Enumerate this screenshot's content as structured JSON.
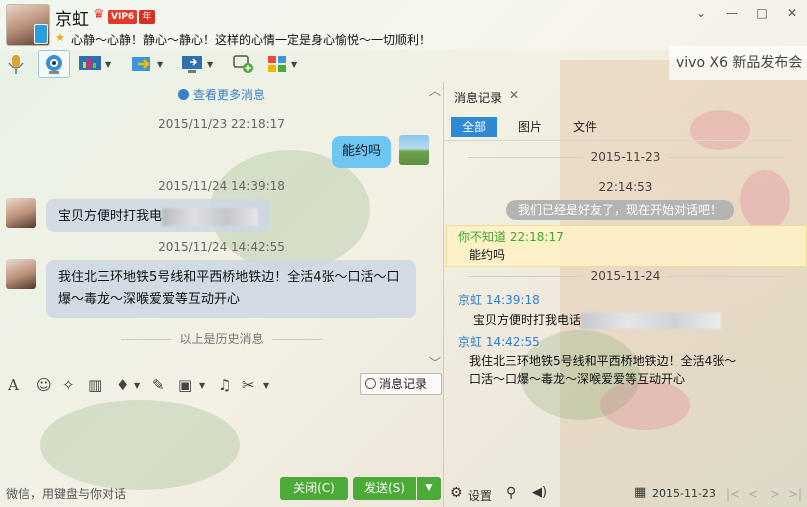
{
  "header": {
    "contact_name": "京虹",
    "vip_label": "VIP6",
    "vip_year": "年",
    "signature": "心静～心静！静心～静心！这样的心情一定是身心愉悦～一切顺利！",
    "banner": "vivo X6 新品发布会"
  },
  "window_controls": {
    "skin": "⌄",
    "minimize": "—",
    "maximize": "□",
    "close": "✕"
  },
  "chat": {
    "more_history": "查看更多消息",
    "history_end": "以上是历史消息",
    "messages": [
      {
        "time": "2015/11/23 22:18:17",
        "text": "能约吗",
        "side": "right"
      },
      {
        "time": "2015/11/24 14:39:18",
        "text": "宝贝方便时打我电",
        "side": "left"
      },
      {
        "time": "2015/11/24 14:42:55",
        "text_line1": "我住北三环地铁5号线和平西桥地铁边！全活4张～口活～口",
        "text_line2": "爆～毒龙～深喉爱爱等互动开心",
        "side": "left"
      }
    ]
  },
  "input": {
    "history_button": "消息记录",
    "hint": "微信，用键盘与你对话",
    "close_button": "关闭(C)",
    "send_button": "发送(S)"
  },
  "history_panel": {
    "title": "消息记录",
    "tabs": [
      "全部",
      "图片",
      "文件"
    ],
    "date1": "2015-11-23",
    "time1": "22:14:53",
    "system_message": "我们已经是好友了，现在开始对话吧！",
    "entries": [
      {
        "sender": "你不知道",
        "time": "22:18:17",
        "text": "能约吗"
      },
      {
        "sender": "京虹",
        "time": "14:39:18",
        "text": "宝贝方便时打我电话"
      },
      {
        "sender": "京虹",
        "time": "14:42:55",
        "text_line1": "我住北三环地铁5号线和平西桥地铁边！全活4张～",
        "text_line2": "口活～口爆～毒龙～深喉爱爱等互动开心"
      }
    ],
    "date2": "2015-11-24",
    "settings": "设置",
    "current_date": "2015-11-23"
  },
  "colors": {
    "accent": "#2f8ad6",
    "bubble_right": "#6ec6f2",
    "bubble_left": "#cdd7e4",
    "button_green": "#4caa39",
    "vip_red": "#e23b2e"
  }
}
